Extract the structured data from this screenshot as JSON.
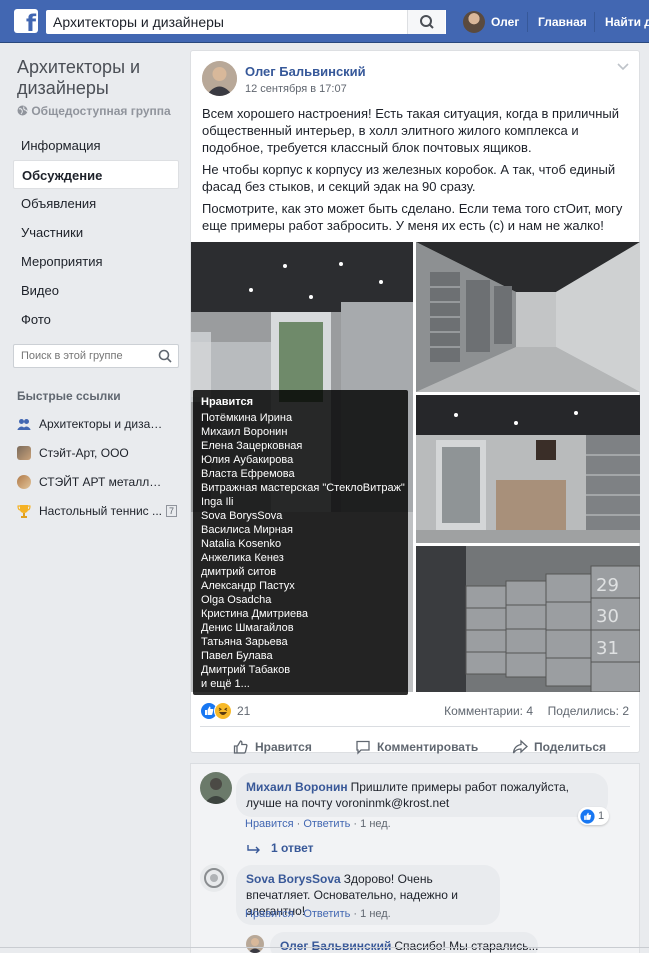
{
  "topbar": {
    "search_value": "Архитекторы и дизайнеры",
    "user_name": "Олег",
    "home_label": "Главная",
    "find_label": "Найти др",
    "brand_color": "#4267b2"
  },
  "group": {
    "title": "Архитекторы и дизайнеры",
    "type": "Общедоступная группа",
    "nav": [
      {
        "label": "Информация"
      },
      {
        "label": "Обсуждение"
      },
      {
        "label": "Объявления"
      },
      {
        "label": "Участники"
      },
      {
        "label": "Мероприятия"
      },
      {
        "label": "Видео"
      },
      {
        "label": "Фото"
      }
    ],
    "search_placeholder": "Поиск в этой группе",
    "quick_links_title": "Быстрые ссылки",
    "quick_links": [
      {
        "label": "Архитекторы и дизайн...",
        "icon": "group-icon"
      },
      {
        "label": "Стэйт-Арт, ООО",
        "icon": "page-icon"
      },
      {
        "label": "СТЭЙТ АРТ металл и ...",
        "icon": "page-icon"
      },
      {
        "label": "Настольный теннис ...",
        "icon": "trophy-icon",
        "count": "7"
      }
    ]
  },
  "post": {
    "author": "Олег Бальвинский",
    "time": "12 сентября в 17:07",
    "paragraphs": [
      "Всем хорошего настроения! Есть такая ситуация, когда в приличный общественный интерьер, в холл элитного жилого комплекса и подобное, требуется классный блок почтовых ящиков.",
      "Не чтобы корпус к корпусу из железных коробок. А так, чтоб единый фасад без стыков, и секций эдак на 90 сразу.",
      "Посмотрите, как это может быть сделано. Если тема того стОит, могу еще примеры работ забросить. У меня их есть (с) и нам не жалко!"
    ],
    "likers_title": "Нравится",
    "likers": [
      "Потёмкина Ирина",
      "Михаил Воронин",
      "Елена Зацерковная",
      "Юлия Аубакирова",
      "Власта Ефремова",
      "Витражная мастерская \"СтеклоВитраж\"",
      "Inga Ili",
      "Sova BorysSova",
      "Василиса Мирная",
      "Natalia Kosenko",
      "Анжелика Кенез",
      "дмитрий ситов",
      "Александр Пастух",
      "Olga Osadcha",
      "Кристина Дмитриева",
      "Денис Шмагайлов",
      "Татьяна Зарьева",
      "Павел Булава",
      "Дмитрий Табаков",
      "и ещё 1..."
    ],
    "reactions_count": "21",
    "comments_count": "Комментарии: 4",
    "shares_count": "Поделились: 2",
    "actions": {
      "like": "Нравится",
      "comment": "Комментировать",
      "share": "Поделиться"
    }
  },
  "comments": [
    {
      "name": "Михаил Воронин",
      "text": "Пришлите примеры работ пожалуйста, лучше на почту voroninmk@krost.net",
      "like": "Нравится",
      "reply": "Ответить",
      "age": "1 нед.",
      "likes": "1"
    },
    {
      "name": "Sova BorysSova",
      "text": "Здорово! Очень впечатляет. Основательно, надежно и элегантно!",
      "like": "Нравится",
      "reply": "Ответить",
      "age": "1 нед."
    },
    {
      "name": "Олег Бальвинский",
      "text": "Спасибо! Мы старались..."
    }
  ],
  "replies_link": "1 ответ"
}
